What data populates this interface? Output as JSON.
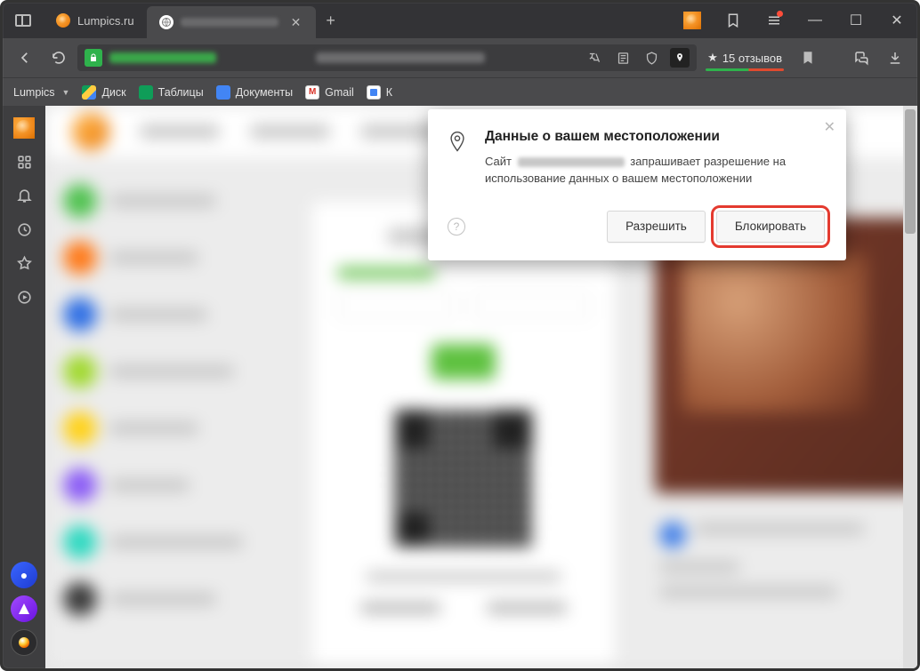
{
  "titlebar": {
    "tab_inactive": "Lumpics.ru",
    "new_tab": "+"
  },
  "addressbar": {
    "reviews_star": "★",
    "reviews": "15 отзывов"
  },
  "bookmarks": {
    "menu": "Lumpics",
    "drive": "Диск",
    "sheets": "Таблицы",
    "docs": "Документы",
    "gmail": "Gmail",
    "calendar": "К"
  },
  "popup": {
    "title": "Данные о вашем местоположении",
    "line_pre": "Сайт",
    "line_post": "запрашивает разрешение на использование данных о вашем местоположении",
    "help": "?",
    "allow": "Разрешить",
    "block": "Блокировать",
    "close": "✕"
  },
  "window": {
    "min": "—",
    "max": "☐",
    "close": "✕"
  }
}
